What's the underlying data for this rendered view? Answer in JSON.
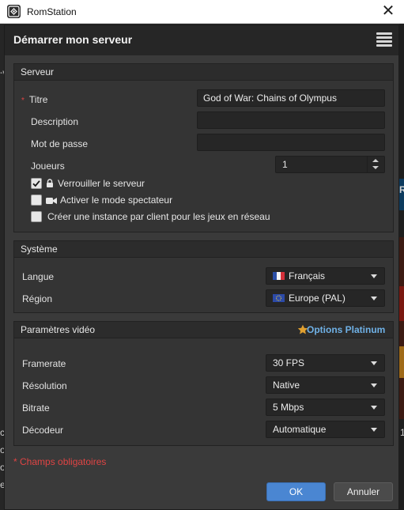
{
  "window": {
    "app_title": "RomStation",
    "close_glyph": "✕"
  },
  "dialog": {
    "title": "Démarrer mon serveur"
  },
  "server": {
    "group_title": "Serveur",
    "required_marker": "*",
    "fields": {
      "title": {
        "label": "Titre",
        "value": "God of War: Chains of Olympus"
      },
      "description": {
        "label": "Description",
        "value": ""
      },
      "password": {
        "label": "Mot de passe",
        "value": ""
      },
      "players": {
        "label": "Joueurs",
        "value": "1"
      }
    },
    "options": {
      "lock": {
        "label": "Verrouiller le serveur",
        "checked": true
      },
      "spectator": {
        "label": "Activer le mode spectateur",
        "checked": false
      },
      "instance": {
        "label": "Créer une instance par client pour les jeux en réseau",
        "checked": false
      }
    }
  },
  "system": {
    "group_title": "Système",
    "language": {
      "label": "Langue",
      "value": "Français"
    },
    "region": {
      "label": "Région",
      "value": "Europe (PAL)"
    }
  },
  "video": {
    "group_title": "Paramètres vidéo",
    "platinum": {
      "label": "Options Platinum",
      "color": "#6fb1e6"
    },
    "framerate": {
      "label": "Framerate",
      "value": "30 FPS"
    },
    "resolution": {
      "label": "Résolution",
      "value": "Native"
    },
    "bitrate": {
      "label": "Bitrate",
      "value": "5 Mbps"
    },
    "decoder": {
      "label": "Décodeur",
      "value": "Automatique"
    }
  },
  "footer": {
    "required_note": "* Champs obligatoires",
    "ok_label": "OK",
    "cancel_label": "Annuler"
  },
  "background_fragments": [
    "-v",
    "R",
    "1",
    "c",
    "o",
    "o",
    "et"
  ],
  "colors": {
    "accent": "#4a86d2",
    "required": "#e04444",
    "platinum": "#6fb1e6",
    "star": "#e0a030"
  }
}
